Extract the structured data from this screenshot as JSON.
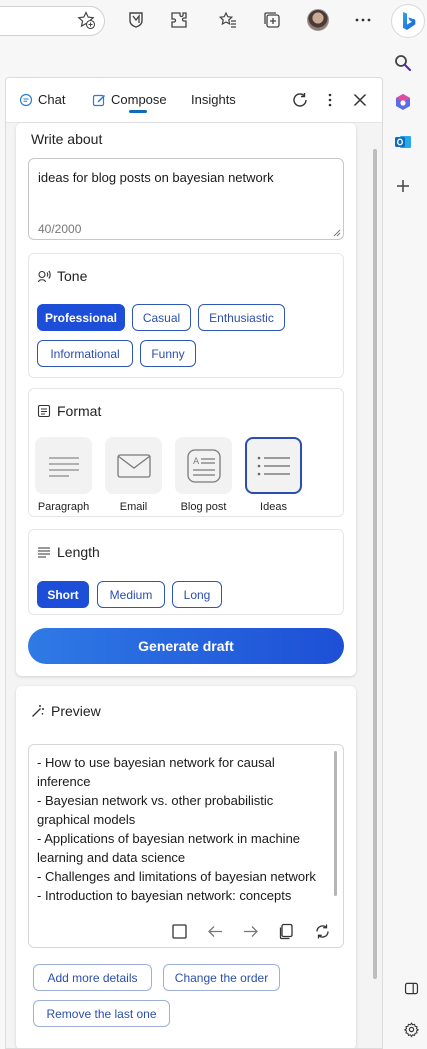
{
  "toolbar": {
    "icons": [
      "add-favorite-icon",
      "shield-icon",
      "extensions-icon",
      "favorites-icon",
      "collections-icon",
      "profile-avatar",
      "more-icon",
      "bing-chat-icon"
    ]
  },
  "sidebar": {
    "icons": [
      "search-icon",
      "office-icon",
      "outlook-icon",
      "add-icon",
      "split-panel-icon",
      "settings-icon"
    ]
  },
  "panel": {
    "tabs": [
      {
        "label": "Chat"
      },
      {
        "label": "Compose"
      },
      {
        "label": "Insights"
      }
    ]
  },
  "compose": {
    "write_about_label": "Write about",
    "topic": "ideas for blog posts on bayesian network",
    "char_count": "40/2000",
    "tone_label": "Tone",
    "tones": [
      "Professional",
      "Casual",
      "Enthusiastic",
      "Informational",
      "Funny"
    ],
    "tone_selected": "Professional",
    "format_label": "Format",
    "formats": [
      "Paragraph",
      "Email",
      "Blog post",
      "Ideas"
    ],
    "format_selected": "Ideas",
    "length_label": "Length",
    "lengths": [
      "Short",
      "Medium",
      "Long"
    ],
    "length_selected": "Short",
    "generate_label": "Generate draft"
  },
  "preview": {
    "label": "Preview",
    "text": "- How to use bayesian network for causal inference\n- Bayesian network vs. other probabilistic graphical models\n- Applications of bayesian network in machine learning and data science\n- Challenges and limitations of bayesian network\n- Introduction to bayesian network: concepts",
    "suggestions": [
      "Add more details",
      "Change the order",
      "Remove the last one"
    ]
  },
  "colors": {
    "accent": "#1d4ed8",
    "pill_border": "#2e56b8"
  }
}
